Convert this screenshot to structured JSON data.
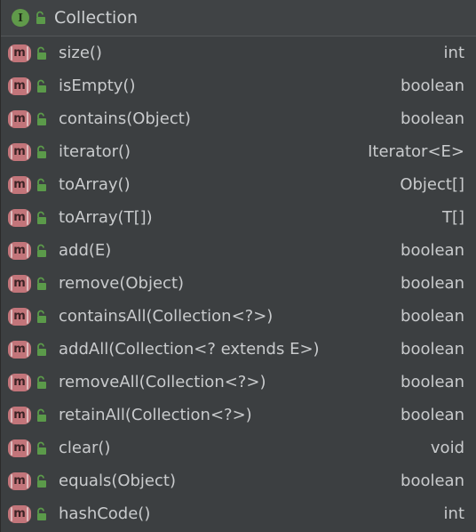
{
  "header": {
    "title": "Collection",
    "interface_glyph": "I",
    "icon": "interface-icon"
  },
  "method_glyph": "m",
  "members": [
    {
      "name": "size()",
      "type": "int"
    },
    {
      "name": "isEmpty()",
      "type": "boolean"
    },
    {
      "name": "contains(Object)",
      "type": "boolean"
    },
    {
      "name": "iterator()",
      "type": "Iterator<E>"
    },
    {
      "name": "toArray()",
      "type": "Object[]"
    },
    {
      "name": "toArray(T[])",
      "type": "T[]"
    },
    {
      "name": "add(E)",
      "type": "boolean"
    },
    {
      "name": "remove(Object)",
      "type": "boolean"
    },
    {
      "name": "containsAll(Collection<?>)",
      "type": "boolean"
    },
    {
      "name": "addAll(Collection<? extends E>)",
      "type": "boolean"
    },
    {
      "name": "removeAll(Collection<?>)",
      "type": "boolean"
    },
    {
      "name": "retainAll(Collection<?>)",
      "type": "boolean"
    },
    {
      "name": "clear()",
      "type": "void"
    },
    {
      "name": "equals(Object)",
      "type": "boolean"
    },
    {
      "name": "hashCode()",
      "type": "int"
    }
  ],
  "colors": {
    "background": "#3c3f41",
    "interface_icon": "#609a4a",
    "method_icon": "#c2757a",
    "lock_icon": "#5b9a4a",
    "text": "#c9cbcd"
  }
}
